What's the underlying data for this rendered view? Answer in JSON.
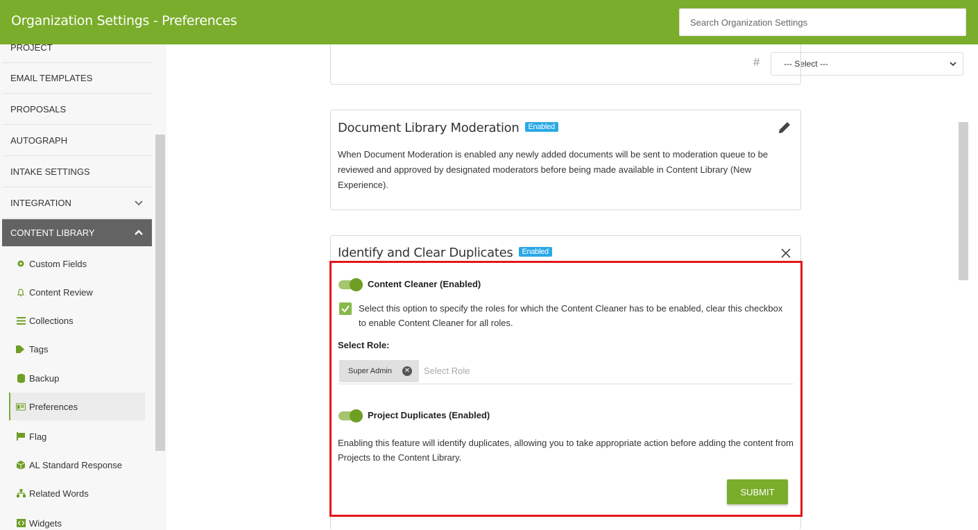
{
  "header": {
    "title": "Organization Settings - Preferences",
    "search_placeholder": "Search Organization Settings"
  },
  "sidebar": {
    "items": [
      {
        "label": "PROJECT"
      },
      {
        "label": "EMAIL TEMPLATES"
      },
      {
        "label": "PROPOSALS"
      },
      {
        "label": "AUTOGRAPH"
      },
      {
        "label": "INTAKE SETTINGS"
      },
      {
        "label": "INTEGRATION"
      },
      {
        "label": "CONTENT LIBRARY"
      }
    ],
    "sub_items": [
      {
        "label": "Custom Fields",
        "icon": "gear-icon"
      },
      {
        "label": "Content Review",
        "icon": "bell-icon"
      },
      {
        "label": "Collections",
        "icon": "list-icon"
      },
      {
        "label": "Tags",
        "icon": "tags-icon"
      },
      {
        "label": "Backup",
        "icon": "database-icon"
      },
      {
        "label": "Preferences",
        "icon": "preferences-icon"
      },
      {
        "label": "Flag",
        "icon": "flag-icon"
      },
      {
        "label": "AL Standard Response",
        "icon": "cube-icon"
      },
      {
        "label": "Related Words",
        "icon": "sitemap-icon"
      },
      {
        "label": "Widgets",
        "icon": "code-icon"
      }
    ]
  },
  "toolbar": {
    "hash_symbol": "#",
    "select_value": "--- Select ---"
  },
  "cards": {
    "document_moderation": {
      "title": "Document Library Moderation",
      "badge": "Enabled",
      "description": "When Document Moderation is enabled any newly added documents will be sent to moderation queue to be reviewed and approved by designated moderators before being made available in Content Library (New Experience)."
    },
    "duplicates": {
      "title": "Identify and Clear Duplicates",
      "badge": "Enabled",
      "content_cleaner_label": "Content Cleaner (Enabled)",
      "checkbox_text": "Select this option to specify the roles for which the Content Cleaner has to be enabled, clear this checkbox to enable Content Cleaner for all roles.",
      "select_role_label": "Select Role:",
      "selected_role": "Super Admin",
      "role_placeholder": "Select Role",
      "project_duplicates_label": "Project Duplicates (Enabled)",
      "project_duplicates_desc": "Enabling this feature will identify duplicates, allowing you to take appropriate action before adding the content from Projects to the Content Library.",
      "submit_label": "SUBMIT"
    }
  },
  "colors": {
    "brand": "#7aad2b",
    "badge": "#2aa8e6",
    "highlight": "#e2161c"
  }
}
